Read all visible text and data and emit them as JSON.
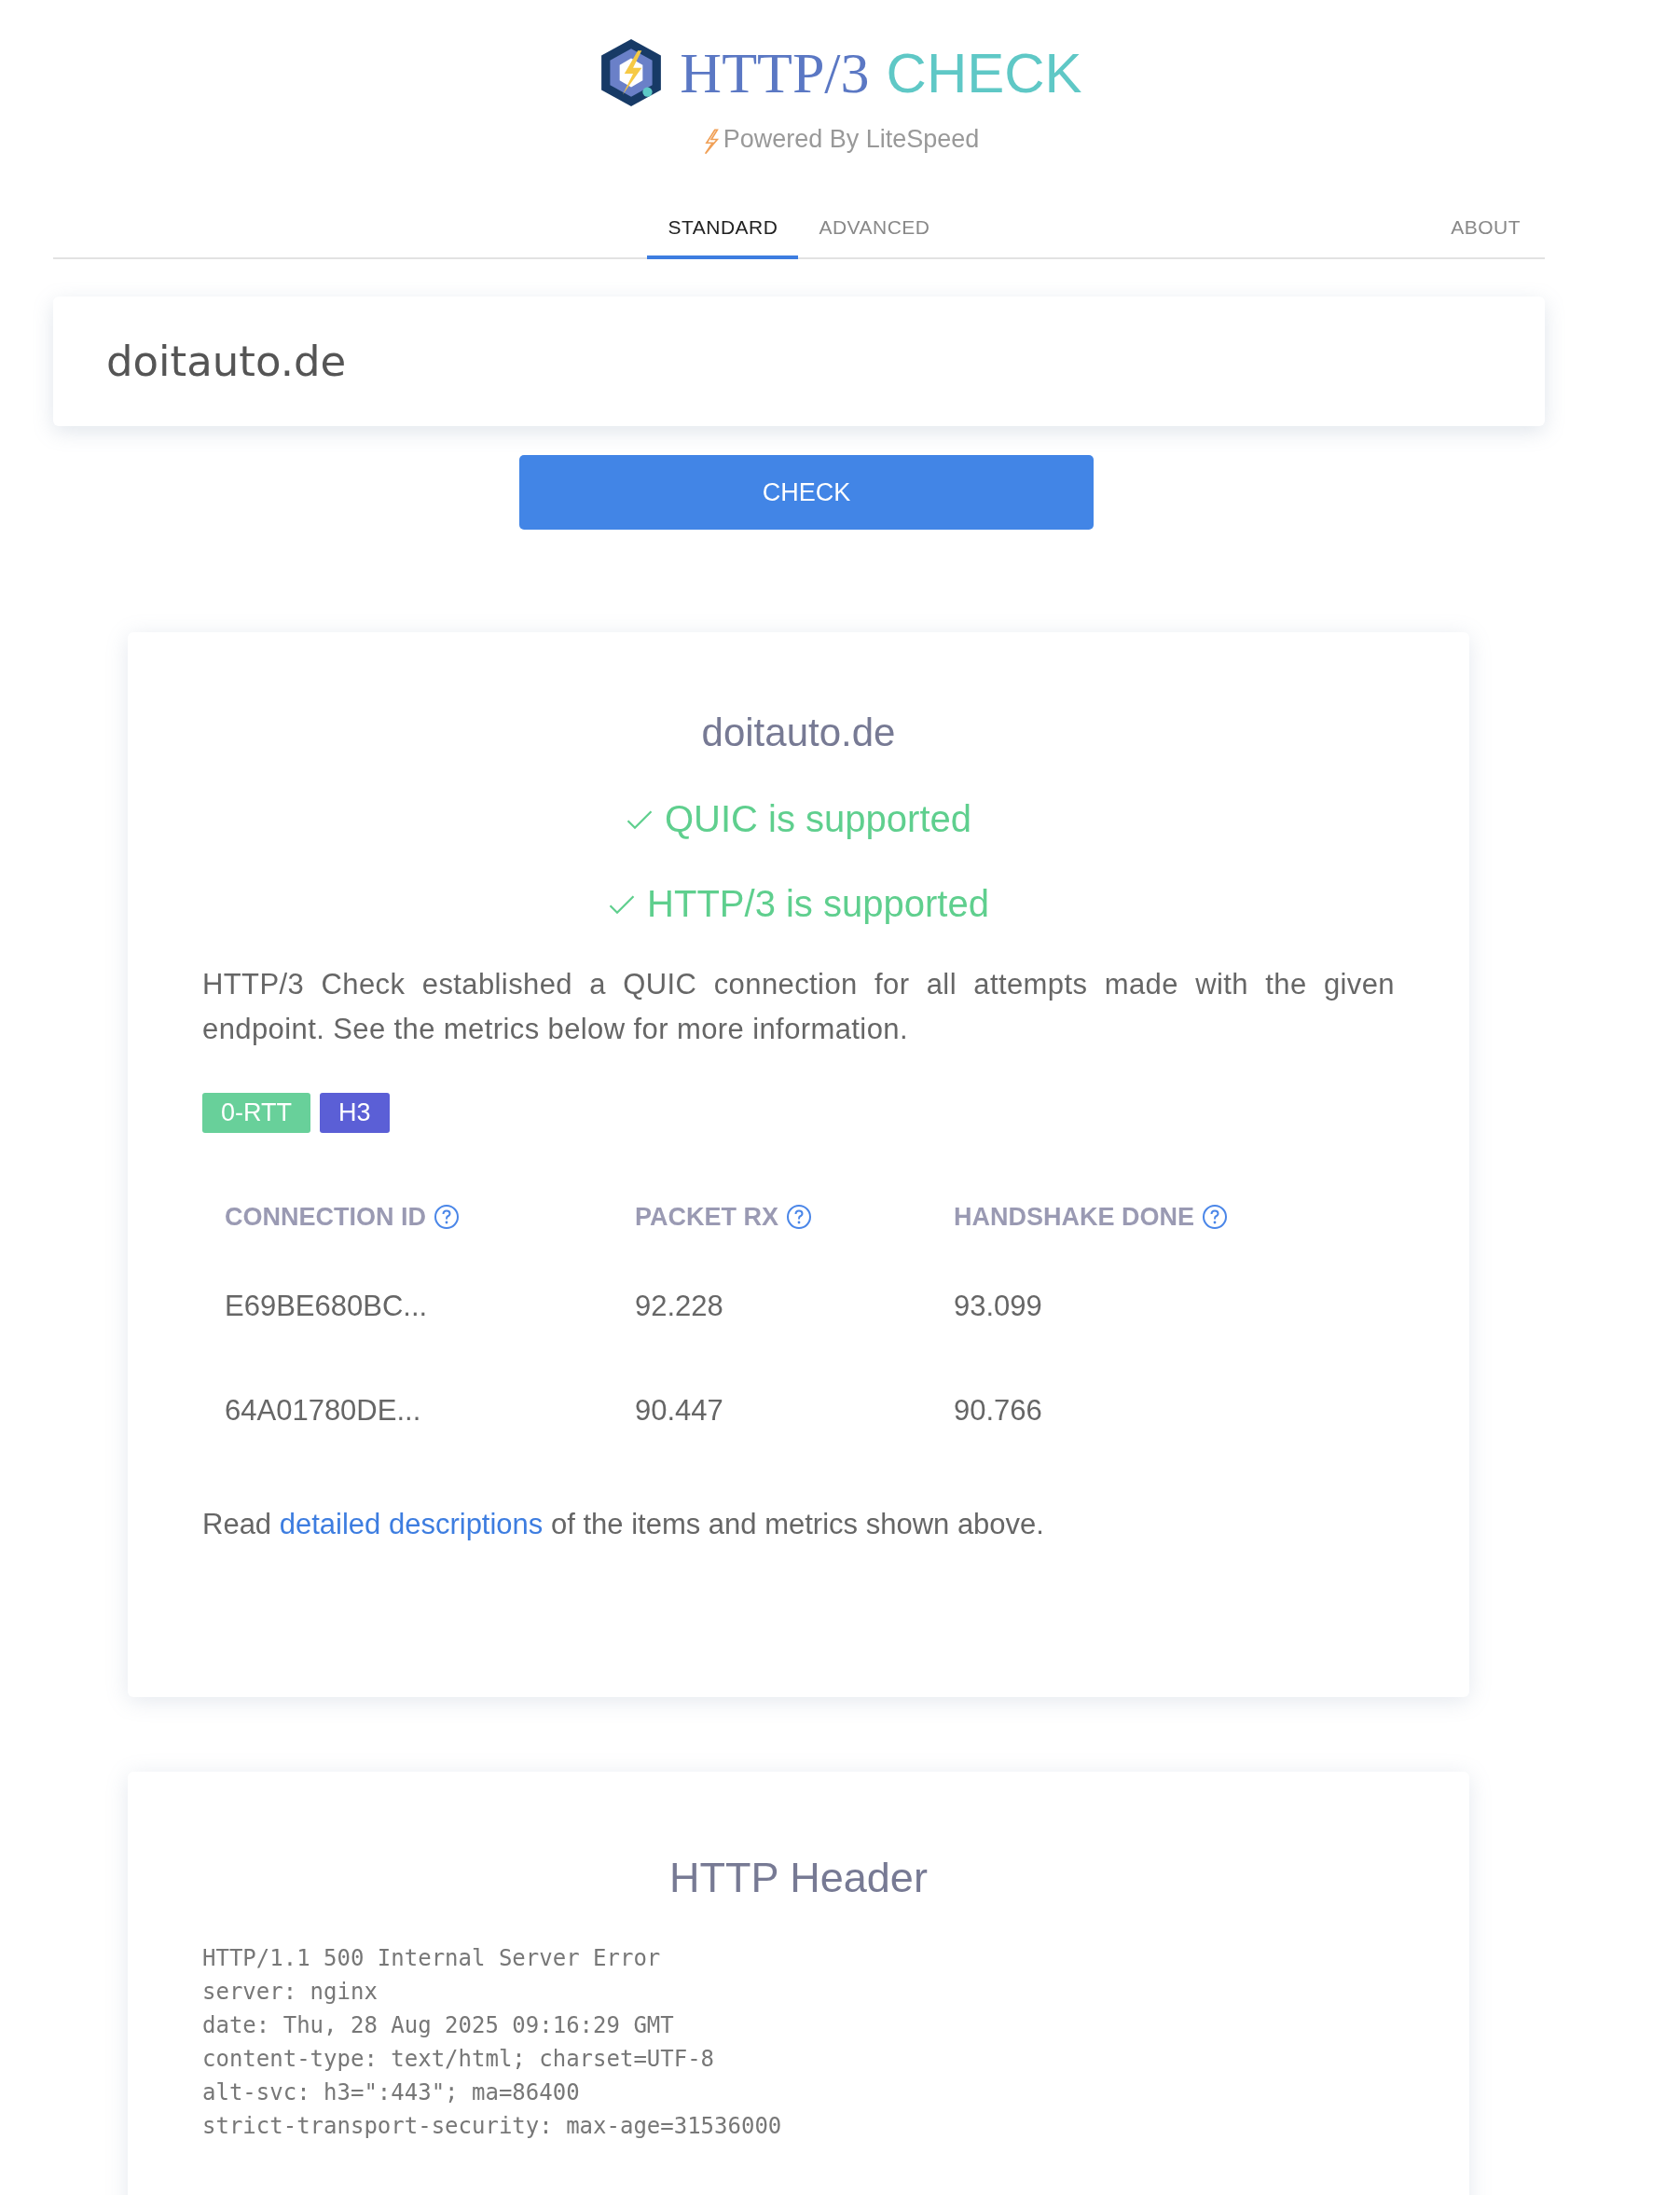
{
  "header": {
    "logo_text_1": "HTTP/3",
    "logo_text_2": "CHECK",
    "powered_by": "Powered By LiteSpeed"
  },
  "nav": {
    "tabs": [
      {
        "label": "STANDARD",
        "selected": true
      },
      {
        "label": "ADVANCED",
        "selected": false
      }
    ],
    "right_tabs": [
      {
        "label": "ABOUT",
        "selected": false
      }
    ]
  },
  "search": {
    "value": "doitauto.de"
  },
  "check_button": "CHECK",
  "result": {
    "domain": "doitauto.de",
    "checks": [
      {
        "label": "QUIC is supported",
        "supported": true
      },
      {
        "label": "HTTP/3 is supported",
        "supported": true
      }
    ],
    "summary": "HTTP/3 Check established a QUIC connection for all attempts made with the given endpoint. See the metrics below for more information.",
    "badges": [
      {
        "label": "0-RTT",
        "color": "#68d09a"
      },
      {
        "label": "H3",
        "color": "#5b5fd6"
      }
    ],
    "table": {
      "columns": [
        "CONNECTION ID",
        "PACKET RX",
        "HANDSHAKE DONE"
      ],
      "rows": [
        [
          "E69BE680BC...",
          "92.228",
          "93.099"
        ],
        [
          "64A01780DE...",
          "90.447",
          "90.766"
        ]
      ]
    },
    "footnote": {
      "before": "Read",
      "link": "detailed descriptions",
      "after": "of the items and metrics shown above."
    }
  },
  "header_card": {
    "title": "HTTP Header",
    "lines": [
      "HTTP/1.1 500 Internal Server Error",
      "server: nginx",
      "date: Thu, 28 Aug 2025 09:16:29 GMT",
      "content-type: text/html; charset=UTF-8",
      "alt-svc: h3=\":443\"; ma=86400",
      "strict-transport-security: max-age=31536000"
    ]
  }
}
